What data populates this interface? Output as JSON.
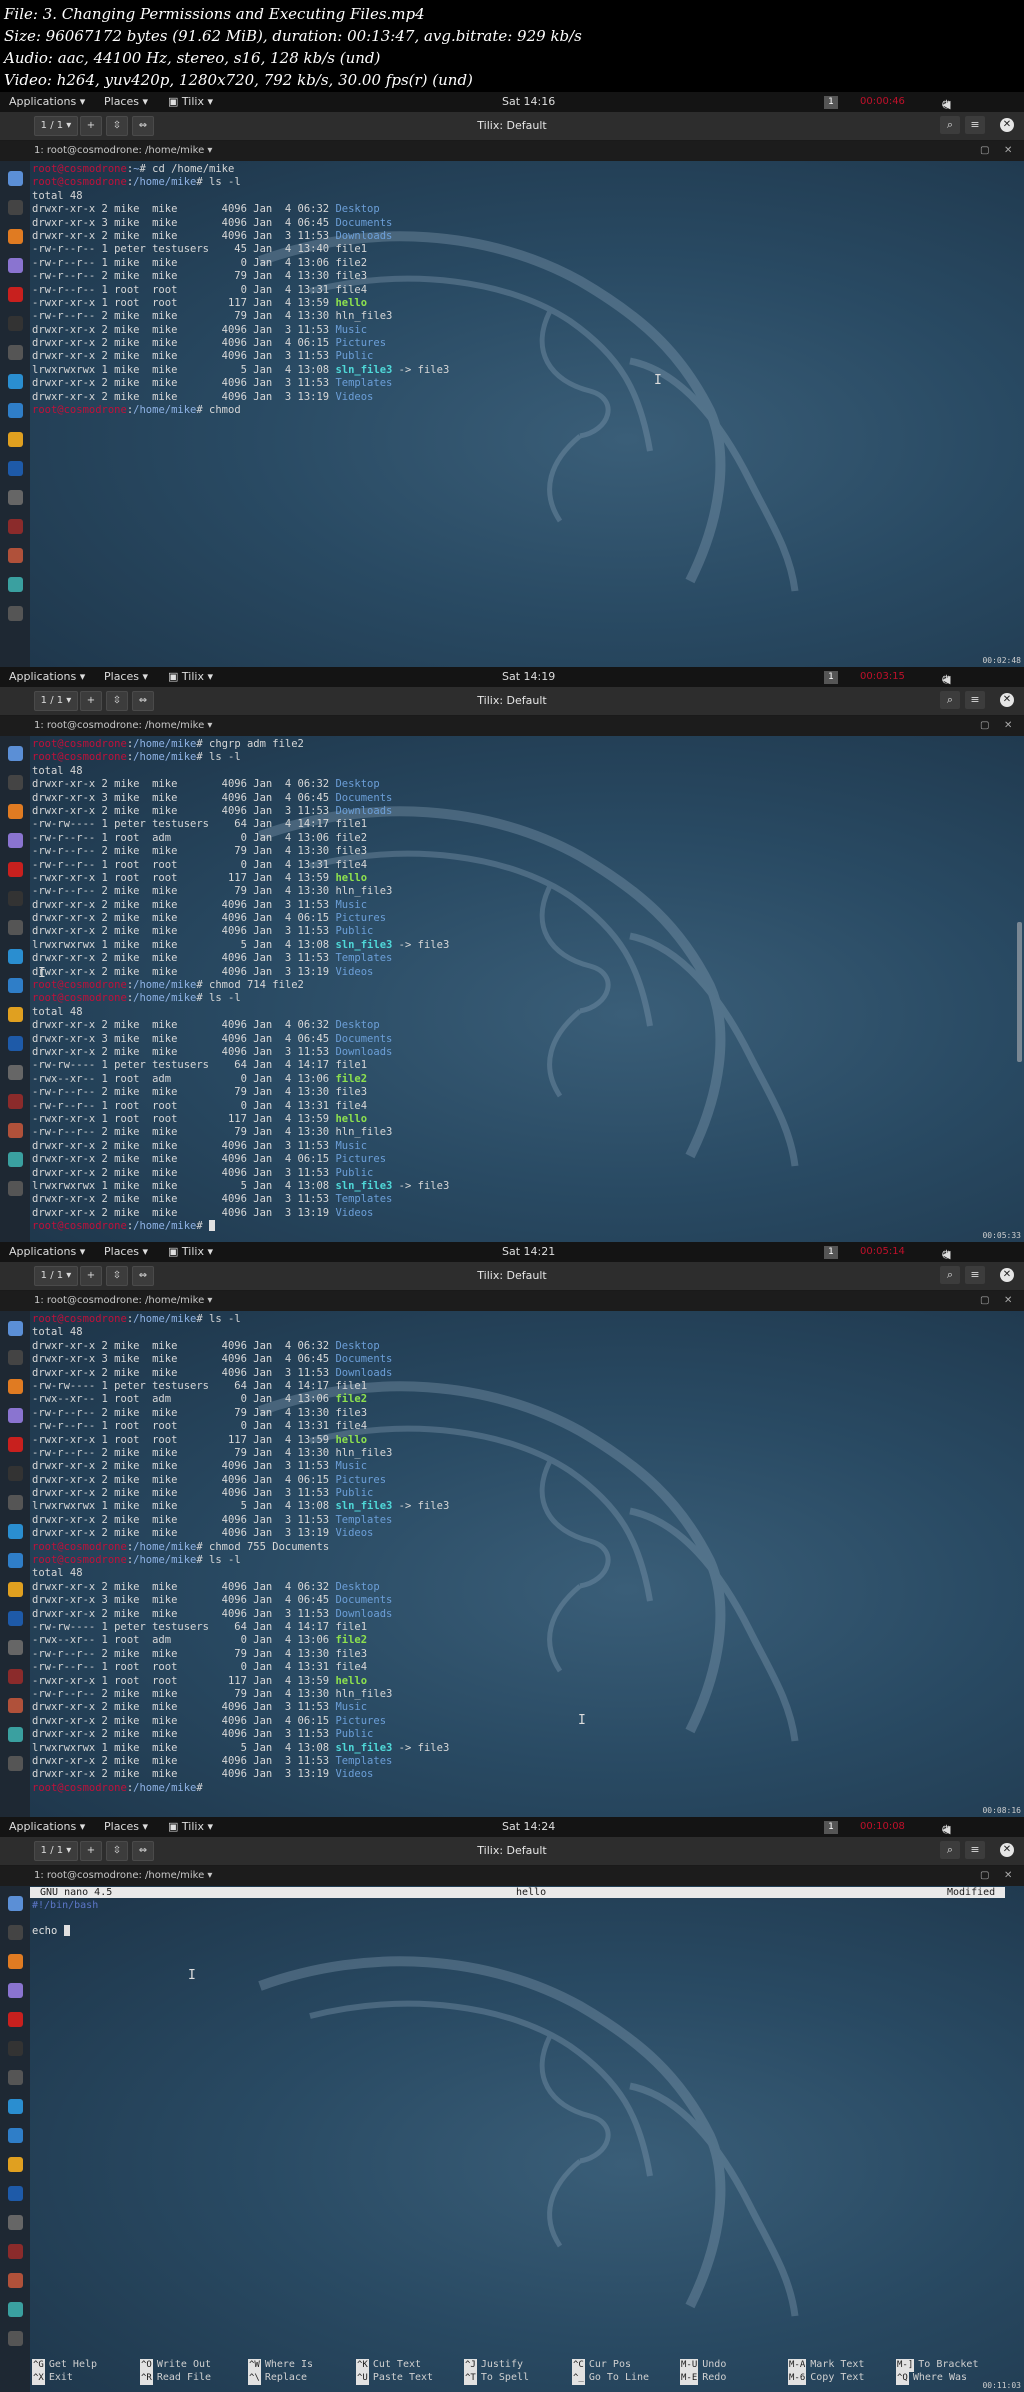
{
  "header": [
    "File: 3. Changing Permissions and Executing Files.mp4",
    "Size: 96067172 bytes (91.62 MiB), duration: 00:13:47, avg.bitrate: 929 kb/s",
    "Audio: aac, 44100 Hz, stereo, s16, 128 kb/s (und)",
    "Video: h264, yuv420p, 1280x720, 792 kb/s, 30.00 fps(r) (und)"
  ],
  "topbar": {
    "applications": "Applications",
    "places": "Places",
    "tilix": "Tilix"
  },
  "prompt": {
    "user": "root@cosmodrone",
    "path": "/home/mike"
  },
  "frames": [
    {
      "clock": "Sat 14:16",
      "workspace": "1",
      "rec": "00:00:46",
      "window_title": "Tilix: Default",
      "tab_counter": "1 / 1",
      "session_label": "1: root@cosmodrone: /home/mike",
      "corner": "00:02:48",
      "lines": [
        {
          "kind": "prompt",
          "path": "~",
          "cmd": "cd /home/mike"
        },
        {
          "kind": "prompt",
          "path": "/home/mike",
          "cmd": "ls -l"
        },
        {
          "kind": "text",
          "text": "total 48"
        },
        {
          "kind": "ls",
          "meta": "drwxr-xr-x 2 mike  mike       4096 Jan  4 06:32",
          "name": "Desktop",
          "type": "dir"
        },
        {
          "kind": "ls",
          "meta": "drwxr-xr-x 3 mike  mike       4096 Jan  4 06:45",
          "name": "Documents",
          "type": "dir"
        },
        {
          "kind": "ls",
          "meta": "drwxr-xr-x 2 mike  mike       4096 Jan  3 11:53",
          "name": "Downloads",
          "type": "dir"
        },
        {
          "kind": "ls",
          "meta": "-rw-r--r-- 1 peter testusers    45 Jan  4 13:40",
          "name": "file1",
          "type": "file"
        },
        {
          "kind": "ls",
          "meta": "-rw-r--r-- 1 mike  mike          0 Jan  4 13:06",
          "name": "file2",
          "type": "file"
        },
        {
          "kind": "ls",
          "meta": "-rw-r--r-- 2 mike  mike         79 Jan  4 13:30",
          "name": "file3",
          "type": "file"
        },
        {
          "kind": "ls",
          "meta": "-rw-r--r-- 1 root  root          0 Jan  4 13:31",
          "name": "file4",
          "type": "file"
        },
        {
          "kind": "ls",
          "meta": "-rwxr-xr-x 1 root  root        117 Jan  4 13:59",
          "name": "hello",
          "type": "exe"
        },
        {
          "kind": "ls",
          "meta": "-rw-r--r-- 2 mike  mike         79 Jan  4 13:30",
          "name": "hln_file3",
          "type": "file"
        },
        {
          "kind": "ls",
          "meta": "drwxr-xr-x 2 mike  mike       4096 Jan  3 11:53",
          "name": "Music",
          "type": "dir"
        },
        {
          "kind": "ls",
          "meta": "drwxr-xr-x 2 mike  mike       4096 Jan  4 06:15",
          "name": "Pictures",
          "type": "dir"
        },
        {
          "kind": "ls",
          "meta": "drwxr-xr-x 2 mike  mike       4096 Jan  3 11:53",
          "name": "Public",
          "type": "dir"
        },
        {
          "kind": "ls",
          "meta": "lrwxrwxrwx 1 mike  mike          5 Jan  4 13:08",
          "name": "sln_file3",
          "type": "link",
          "target": "file3"
        },
        {
          "kind": "ls",
          "meta": "drwxr-xr-x 2 mike  mike       4096 Jan  3 11:53",
          "name": "Templates",
          "type": "dir"
        },
        {
          "kind": "ls",
          "meta": "drwxr-xr-x 2 mike  mike       4096 Jan  3 13:19",
          "name": "Videos",
          "type": "dir"
        },
        {
          "kind": "prompt",
          "path": "/home/mike",
          "cmd": "chmod "
        }
      ]
    },
    {
      "clock": "Sat 14:19",
      "workspace": "1",
      "rec": "00:03:15",
      "window_title": "Tilix: Default",
      "tab_counter": "1 / 1",
      "session_label": "1: root@cosmodrone: /home/mike",
      "corner": "00:05:33",
      "lines": [
        {
          "kind": "prompt",
          "path": "/home/mike",
          "cmd": "chgrp adm file2"
        },
        {
          "kind": "prompt",
          "path": "/home/mike",
          "cmd": "ls -l"
        },
        {
          "kind": "text",
          "text": "total 48"
        },
        {
          "kind": "ls",
          "meta": "drwxr-xr-x 2 mike  mike       4096 Jan  4 06:32",
          "name": "Desktop",
          "type": "dir"
        },
        {
          "kind": "ls",
          "meta": "drwxr-xr-x 3 mike  mike       4096 Jan  4 06:45",
          "name": "Documents",
          "type": "dir"
        },
        {
          "kind": "ls",
          "meta": "drwxr-xr-x 2 mike  mike       4096 Jan  3 11:53",
          "name": "Downloads",
          "type": "dir"
        },
        {
          "kind": "ls",
          "meta": "-rw-rw---- 1 peter testusers    64 Jan  4 14:17",
          "name": "file1",
          "type": "file"
        },
        {
          "kind": "ls",
          "meta": "-rw-r--r-- 1 root  adm           0 Jan  4 13:06",
          "name": "file2",
          "type": "file"
        },
        {
          "kind": "ls",
          "meta": "-rw-r--r-- 2 mike  mike         79 Jan  4 13:30",
          "name": "file3",
          "type": "file"
        },
        {
          "kind": "ls",
          "meta": "-rw-r--r-- 1 root  root          0 Jan  4 13:31",
          "name": "file4",
          "type": "file"
        },
        {
          "kind": "ls",
          "meta": "-rwxr-xr-x 1 root  root        117 Jan  4 13:59",
          "name": "hello",
          "type": "exe"
        },
        {
          "kind": "ls",
          "meta": "-rw-r--r-- 2 mike  mike         79 Jan  4 13:30",
          "name": "hln_file3",
          "type": "file"
        },
        {
          "kind": "ls",
          "meta": "drwxr-xr-x 2 mike  mike       4096 Jan  3 11:53",
          "name": "Music",
          "type": "dir"
        },
        {
          "kind": "ls",
          "meta": "drwxr-xr-x 2 mike  mike       4096 Jan  4 06:15",
          "name": "Pictures",
          "type": "dir"
        },
        {
          "kind": "ls",
          "meta": "drwxr-xr-x 2 mike  mike       4096 Jan  3 11:53",
          "name": "Public",
          "type": "dir"
        },
        {
          "kind": "ls",
          "meta": "lrwxrwxrwx 1 mike  mike          5 Jan  4 13:08",
          "name": "sln_file3",
          "type": "link",
          "target": "file3"
        },
        {
          "kind": "ls",
          "meta": "drwxr-xr-x 2 mike  mike       4096 Jan  3 11:53",
          "name": "Templates",
          "type": "dir"
        },
        {
          "kind": "ls",
          "meta": "drwxr-xr-x 2 mike  mike       4096 Jan  3 13:19",
          "name": "Videos",
          "type": "dir"
        },
        {
          "kind": "prompt",
          "path": "/home/mike",
          "cmd": "chmod 714 file2"
        },
        {
          "kind": "prompt",
          "path": "/home/mike",
          "cmd": "ls -l"
        },
        {
          "kind": "text",
          "text": "total 48"
        },
        {
          "kind": "ls",
          "meta": "drwxr-xr-x 2 mike  mike       4096 Jan  4 06:32",
          "name": "Desktop",
          "type": "dir"
        },
        {
          "kind": "ls",
          "meta": "drwxr-xr-x 3 mike  mike       4096 Jan  4 06:45",
          "name": "Documents",
          "type": "dir"
        },
        {
          "kind": "ls",
          "meta": "drwxr-xr-x 2 mike  mike       4096 Jan  3 11:53",
          "name": "Downloads",
          "type": "dir"
        },
        {
          "kind": "ls",
          "meta": "-rw-rw---- 1 peter testusers    64 Jan  4 14:17",
          "name": "file1",
          "type": "file"
        },
        {
          "kind": "ls",
          "meta": "-rwx--xr-- 1 root  adm           0 Jan  4 13:06",
          "name": "file2",
          "type": "exe"
        },
        {
          "kind": "ls",
          "meta": "-rw-r--r-- 2 mike  mike         79 Jan  4 13:30",
          "name": "file3",
          "type": "file"
        },
        {
          "kind": "ls",
          "meta": "-rw-r--r-- 1 root  root          0 Jan  4 13:31",
          "name": "file4",
          "type": "file"
        },
        {
          "kind": "ls",
          "meta": "-rwxr-xr-x 1 root  root        117 Jan  4 13:59",
          "name": "hello",
          "type": "exe"
        },
        {
          "kind": "ls",
          "meta": "-rw-r--r-- 2 mike  mike         79 Jan  4 13:30",
          "name": "hln_file3",
          "type": "file"
        },
        {
          "kind": "ls",
          "meta": "drwxr-xr-x 2 mike  mike       4096 Jan  3 11:53",
          "name": "Music",
          "type": "dir"
        },
        {
          "kind": "ls",
          "meta": "drwxr-xr-x 2 mike  mike       4096 Jan  4 06:15",
          "name": "Pictures",
          "type": "dir"
        },
        {
          "kind": "ls",
          "meta": "drwxr-xr-x 2 mike  mike       4096 Jan  3 11:53",
          "name": "Public",
          "type": "dir"
        },
        {
          "kind": "ls",
          "meta": "lrwxrwxrwx 1 mike  mike          5 Jan  4 13:08",
          "name": "sln_file3",
          "type": "link",
          "target": "file3"
        },
        {
          "kind": "ls",
          "meta": "drwxr-xr-x 2 mike  mike       4096 Jan  3 11:53",
          "name": "Templates",
          "type": "dir"
        },
        {
          "kind": "ls",
          "meta": "drwxr-xr-x 2 mike  mike       4096 Jan  3 13:19",
          "name": "Videos",
          "type": "dir"
        },
        {
          "kind": "prompt",
          "path": "/home/mike",
          "cmd": "",
          "cursor": true
        }
      ]
    },
    {
      "clock": "Sat 14:21",
      "workspace": "1",
      "rec": "00:05:14",
      "window_title": "Tilix: Default",
      "tab_counter": "1 / 1",
      "session_label": "1: root@cosmodrone: /home/mike",
      "corner": "00:08:16",
      "lines": [
        {
          "kind": "prompt",
          "path": "/home/mike",
          "cmd": "ls -l"
        },
        {
          "kind": "text",
          "text": "total 48"
        },
        {
          "kind": "ls",
          "meta": "drwxr-xr-x 2 mike  mike       4096 Jan  4 06:32",
          "name": "Desktop",
          "type": "dir"
        },
        {
          "kind": "ls",
          "meta": "drwxr-xr-x 3 mike  mike       4096 Jan  4 06:45",
          "name": "Documents",
          "type": "dir"
        },
        {
          "kind": "ls",
          "meta": "drwxr-xr-x 2 mike  mike       4096 Jan  3 11:53",
          "name": "Downloads",
          "type": "dir"
        },
        {
          "kind": "ls",
          "meta": "-rw-rw---- 1 peter testusers    64 Jan  4 14:17",
          "name": "file1",
          "type": "file"
        },
        {
          "kind": "ls",
          "meta": "-rwx--xr-- 1 root  adm           0 Jan  4 13:06",
          "name": "file2",
          "type": "exe"
        },
        {
          "kind": "ls",
          "meta": "-rw-r--r-- 2 mike  mike         79 Jan  4 13:30",
          "name": "file3",
          "type": "file"
        },
        {
          "kind": "ls",
          "meta": "-rw-r--r-- 1 root  root          0 Jan  4 13:31",
          "name": "file4",
          "type": "file"
        },
        {
          "kind": "ls",
          "meta": "-rwxr-xr-x 1 root  root        117 Jan  4 13:59",
          "name": "hello",
          "type": "exe"
        },
        {
          "kind": "ls",
          "meta": "-rw-r--r-- 2 mike  mike         79 Jan  4 13:30",
          "name": "hln_file3",
          "type": "file"
        },
        {
          "kind": "ls",
          "meta": "drwxr-xr-x 2 mike  mike       4096 Jan  3 11:53",
          "name": "Music",
          "type": "dir"
        },
        {
          "kind": "ls",
          "meta": "drwxr-xr-x 2 mike  mike       4096 Jan  4 06:15",
          "name": "Pictures",
          "type": "dir"
        },
        {
          "kind": "ls",
          "meta": "drwxr-xr-x 2 mike  mike       4096 Jan  3 11:53",
          "name": "Public",
          "type": "dir"
        },
        {
          "kind": "ls",
          "meta": "lrwxrwxrwx 1 mike  mike          5 Jan  4 13:08",
          "name": "sln_file3",
          "type": "link",
          "target": "file3"
        },
        {
          "kind": "ls",
          "meta": "drwxr-xr-x 2 mike  mike       4096 Jan  3 11:53",
          "name": "Templates",
          "type": "dir"
        },
        {
          "kind": "ls",
          "meta": "drwxr-xr-x 2 mike  mike       4096 Jan  3 13:19",
          "name": "Videos",
          "type": "dir"
        },
        {
          "kind": "prompt",
          "path": "/home/mike",
          "cmd": "chmod 755 Documents"
        },
        {
          "kind": "prompt",
          "path": "/home/mike",
          "cmd": "ls -l"
        },
        {
          "kind": "text",
          "text": "total 48"
        },
        {
          "kind": "ls",
          "meta": "drwxr-xr-x 2 mike  mike       4096 Jan  4 06:32",
          "name": "Desktop",
          "type": "dir"
        },
        {
          "kind": "ls",
          "meta": "drwxr-xr-x 3 mike  mike       4096 Jan  4 06:45",
          "name": "Documents",
          "type": "dir"
        },
        {
          "kind": "ls",
          "meta": "drwxr-xr-x 2 mike  mike       4096 Jan  3 11:53",
          "name": "Downloads",
          "type": "dir"
        },
        {
          "kind": "ls",
          "meta": "-rw-rw---- 1 peter testusers    64 Jan  4 14:17",
          "name": "file1",
          "type": "file"
        },
        {
          "kind": "ls",
          "meta": "-rwx--xr-- 1 root  adm           0 Jan  4 13:06",
          "name": "file2",
          "type": "exe"
        },
        {
          "kind": "ls",
          "meta": "-rw-r--r-- 2 mike  mike         79 Jan  4 13:30",
          "name": "file3",
          "type": "file"
        },
        {
          "kind": "ls",
          "meta": "-rw-r--r-- 1 root  root          0 Jan  4 13:31",
          "name": "file4",
          "type": "file"
        },
        {
          "kind": "ls",
          "meta": "-rwxr-xr-x 1 root  root        117 Jan  4 13:59",
          "name": "hello",
          "type": "exe"
        },
        {
          "kind": "ls",
          "meta": "-rw-r--r-- 2 mike  mike         79 Jan  4 13:30",
          "name": "hln_file3",
          "type": "file"
        },
        {
          "kind": "ls",
          "meta": "drwxr-xr-x 2 mike  mike       4096 Jan  3 11:53",
          "name": "Music",
          "type": "dir"
        },
        {
          "kind": "ls",
          "meta": "drwxr-xr-x 2 mike  mike       4096 Jan  4 06:15",
          "name": "Pictures",
          "type": "dir"
        },
        {
          "kind": "ls",
          "meta": "drwxr-xr-x 2 mike  mike       4096 Jan  3 11:53",
          "name": "Public",
          "type": "dir"
        },
        {
          "kind": "ls",
          "meta": "lrwxrwxrwx 1 mike  mike          5 Jan  4 13:08",
          "name": "sln_file3",
          "type": "link",
          "target": "file3"
        },
        {
          "kind": "ls",
          "meta": "drwxr-xr-x 2 mike  mike       4096 Jan  3 11:53",
          "name": "Templates",
          "type": "dir"
        },
        {
          "kind": "ls",
          "meta": "drwxr-xr-x 2 mike  mike       4096 Jan  3 13:19",
          "name": "Videos",
          "type": "dir"
        },
        {
          "kind": "prompt",
          "path": "/home/mike",
          "cmd": ""
        }
      ]
    },
    {
      "clock": "Sat 14:24",
      "workspace": "1",
      "rec": "00:10:08",
      "window_title": "Tilix: Default",
      "tab_counter": "1 / 1",
      "session_label": "1: root@cosmodrone: /home/mike",
      "corner": "00:11:03",
      "nano": {
        "version": "GNU nano 4.5",
        "filename": "hello",
        "status": "Modified",
        "shebang": "#!/bin/bash",
        "line": "echo ",
        "help": [
          {
            "k1": "^G",
            "a1": "Get Help",
            "k2": "^X",
            "a2": "Exit"
          },
          {
            "k1": "^O",
            "a1": "Write Out",
            "k2": "^R",
            "a2": "Read File"
          },
          {
            "k1": "^W",
            "a1": "Where Is",
            "k2": "^\\",
            "a2": "Replace"
          },
          {
            "k1": "^K",
            "a1": "Cut Text",
            "k2": "^U",
            "a2": "Paste Text"
          },
          {
            "k1": "^J",
            "a1": "Justify",
            "k2": "^T",
            "a2": "To Spell"
          },
          {
            "k1": "^C",
            "a1": "Cur Pos",
            "k2": "^_",
            "a2": "Go To Line"
          },
          {
            "k1": "M-U",
            "a1": "Undo",
            "k2": "M-E",
            "a2": "Redo"
          },
          {
            "k1": "M-A",
            "a1": "Mark Text",
            "k2": "M-6",
            "a2": "Copy Text"
          },
          {
            "k1": "M-]",
            "a1": "To Bracket",
            "k2": "^Q",
            "a2": "Where Was"
          }
        ]
      }
    }
  ]
}
